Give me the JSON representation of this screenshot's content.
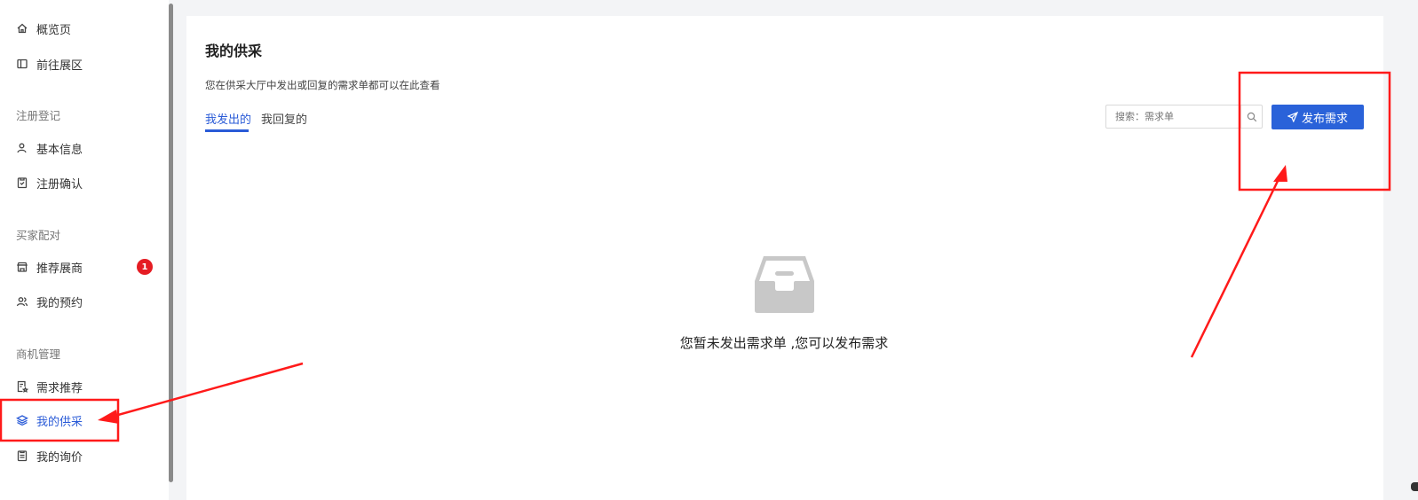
{
  "sidebar": {
    "items": [
      {
        "label": "概览页",
        "icon": "home-icon"
      },
      {
        "label": "前往展区",
        "icon": "book-icon"
      },
      {
        "label": "基本信息",
        "icon": "user-icon"
      },
      {
        "label": "注册确认",
        "icon": "clipboard-icon"
      },
      {
        "label": "推荐展商",
        "icon": "store-icon",
        "badge": "1"
      },
      {
        "label": "我的预约",
        "icon": "users-icon"
      },
      {
        "label": "需求推荐",
        "icon": "doc-star-icon"
      },
      {
        "label": "我的供采",
        "icon": "layers-icon",
        "active": true
      },
      {
        "label": "我的询价",
        "icon": "list-icon"
      }
    ],
    "sections": [
      "注册登记",
      "买家配对",
      "商机管理"
    ]
  },
  "main": {
    "title": "我的供采",
    "description": "您在供采大厅中发出或回复的需求单都可以在此查看",
    "tabs": [
      {
        "label": "我发出的",
        "active": true
      },
      {
        "label": "我回复的",
        "active": false
      }
    ],
    "search": {
      "placeholder": "搜索：需求单",
      "value": ""
    },
    "publish_button": "发布需求",
    "empty_state": "您暂未发出需求单 ,您可以发布需求"
  },
  "colors": {
    "accent": "#2a5bd7",
    "button": "#2a62d9",
    "badge": "#e51c23",
    "annotation": "#ff1a1a"
  }
}
